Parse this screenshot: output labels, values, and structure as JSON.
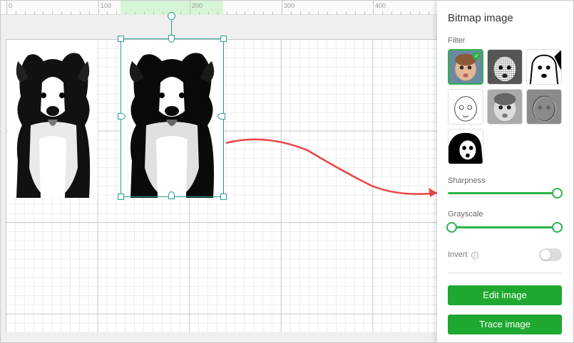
{
  "ruler": {
    "labels": [
      "0",
      "100",
      "200",
      "300",
      "400"
    ]
  },
  "canvas": {
    "accent_color": "#2a9d8f",
    "arrow_color": "#e84545"
  },
  "panel": {
    "title": "Bitmap image",
    "filter_label": "Filter",
    "filters": [
      {
        "name": "original",
        "selected": true
      },
      {
        "name": "halftone",
        "selected": false
      },
      {
        "name": "high-contrast",
        "selected": false
      },
      {
        "name": "sketch",
        "selected": false
      },
      {
        "name": "grayscale",
        "selected": false
      },
      {
        "name": "emboss",
        "selected": false
      },
      {
        "name": "threshold",
        "selected": false
      }
    ],
    "sharpness": {
      "label": "Sharpness",
      "value": 1.0
    },
    "grayscale": {
      "label": "Grayscale",
      "range": [
        0.0,
        1.0
      ]
    },
    "invert": {
      "label": "Invert",
      "enabled": false
    },
    "edit_button": "Edit image",
    "trace_button": "Trace image",
    "accent_color": "#2db24a",
    "button_color": "#1fa830"
  }
}
